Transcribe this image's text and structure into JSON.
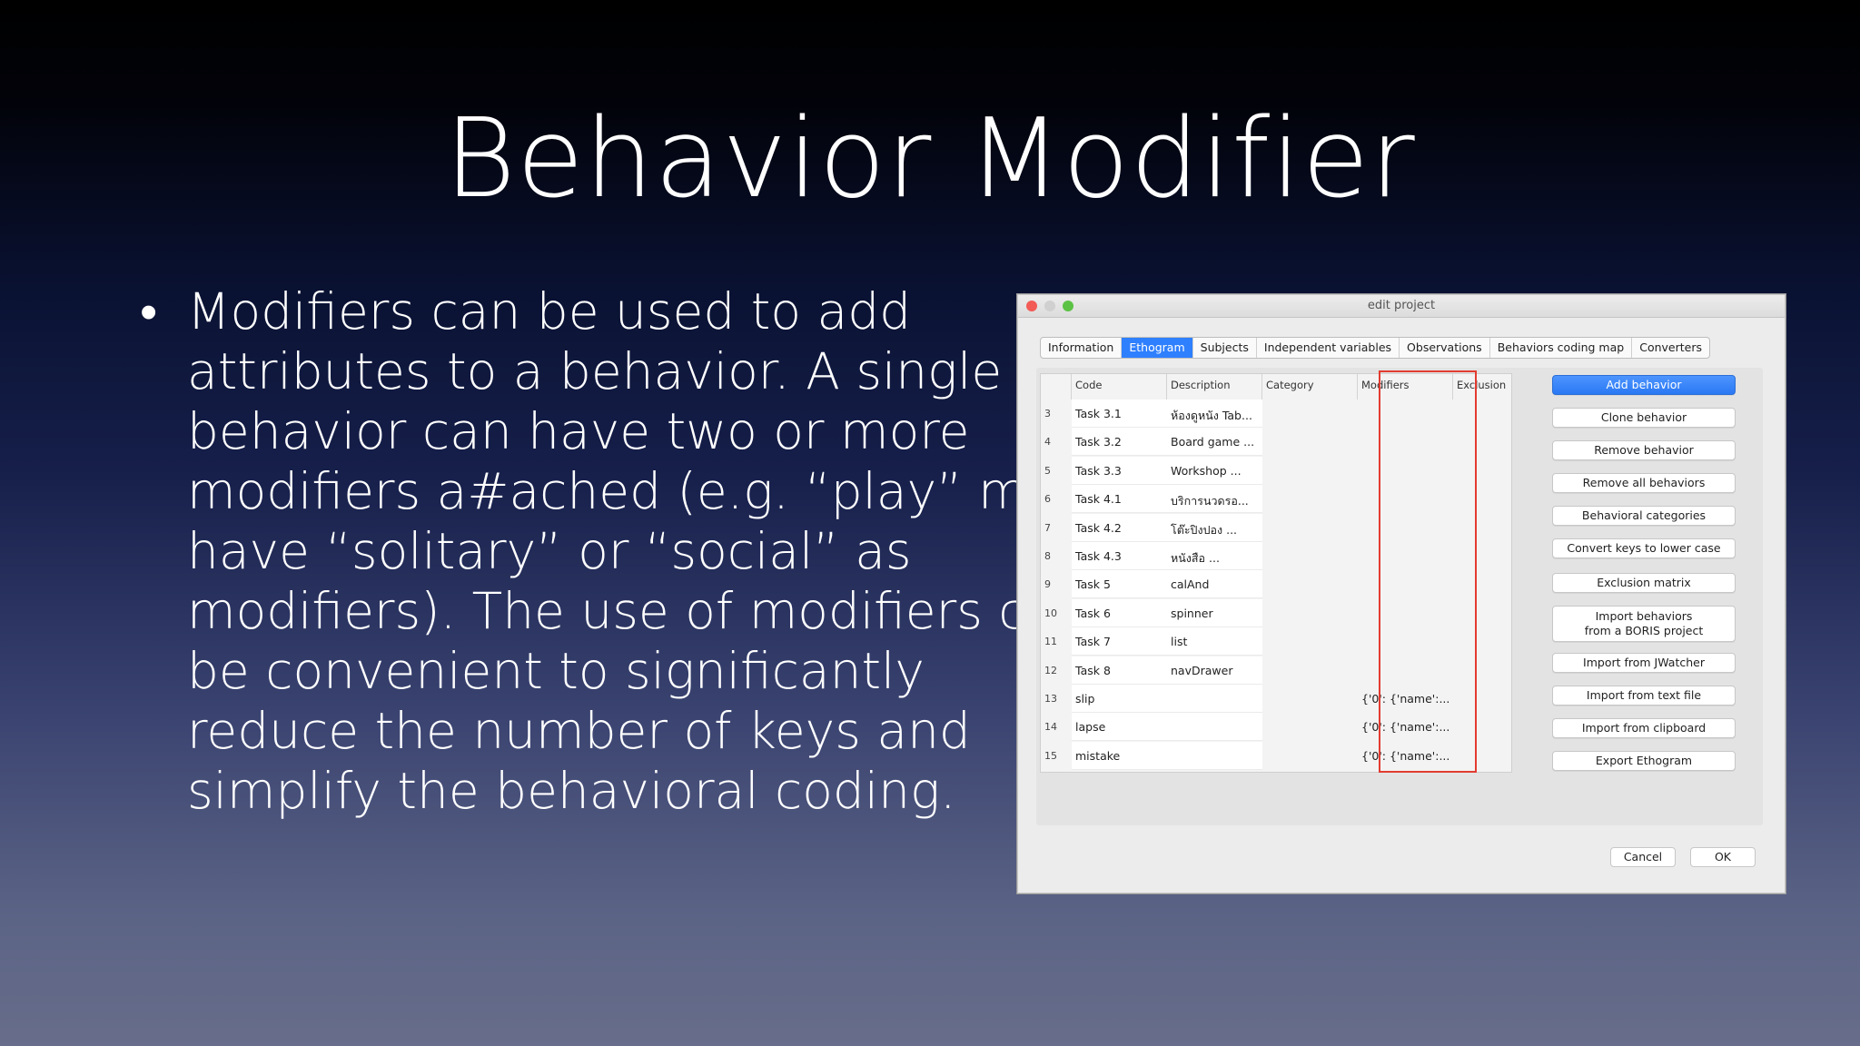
{
  "slide": {
    "title": "Behavior Modifier",
    "bullet": "Modifiers can be used to add\nattributes to a behavior. A single\nbehavior can have two or more\nmodifiers a#ached (e.g. “play” may\nhave “solitary” or “social” as\nmodifiers). The use of modifiers can\nbe convenient to significantly\nreduce the number of keys and\nsimplify the behavioral coding."
  },
  "window": {
    "title": "edit project",
    "tabs": [
      "Information",
      "Ethogram",
      "Subjects",
      "Independent variables",
      "Observations",
      "Behaviors coding map",
      "Converters"
    ],
    "active_tab": "Ethogram",
    "columns": {
      "code": "Code",
      "description": "Description",
      "category": "Category",
      "modifiers": "Modifiers",
      "exclusion": "Exclusion"
    },
    "rows": [
      {
        "idx": "3",
        "code": "Task 3.1",
        "desc": "ห้องดูหนัง Tab...",
        "mod": ""
      },
      {
        "idx": "4",
        "code": "Task 3.2",
        "desc": "Board game ...",
        "mod": ""
      },
      {
        "idx": "5",
        "code": "Task 3.3",
        "desc": "Workshop ...",
        "mod": ""
      },
      {
        "idx": "6",
        "code": "Task 4.1",
        "desc": "บริการนวดรอ...",
        "mod": ""
      },
      {
        "idx": "7",
        "code": "Task 4.2",
        "desc": "โต๊ะปิงปอง ...",
        "mod": ""
      },
      {
        "idx": "8",
        "code": "Task 4.3",
        "desc": "หนังสือ ...",
        "mod": ""
      },
      {
        "idx": "9",
        "code": "Task 5",
        "desc": "calAnd",
        "mod": ""
      },
      {
        "idx": "10",
        "code": "Task 6",
        "desc": "spinner",
        "mod": ""
      },
      {
        "idx": "11",
        "code": "Task 7",
        "desc": "list",
        "mod": ""
      },
      {
        "idx": "12",
        "code": "Task 8",
        "desc": "navDrawer",
        "mod": ""
      },
      {
        "idx": "13",
        "code": "slip",
        "desc": "",
        "mod": "{'0': {'name':..."
      },
      {
        "idx": "14",
        "code": "lapse",
        "desc": "",
        "mod": "{'0': {'name':..."
      },
      {
        "idx": "15",
        "code": "mistake",
        "desc": "",
        "mod": "{'0': {'name':..."
      }
    ],
    "buttons": {
      "add": "Add behavior",
      "clone": "Clone behavior",
      "remove": "Remove behavior",
      "remove_all": "Remove all behaviors",
      "categories": "Behavioral categories",
      "lower": "Convert keys to lower case",
      "exclusion": "Exclusion matrix",
      "import_boris": "Import behaviors\nfrom a BORIS project",
      "import_jwatcher": "Import from JWatcher",
      "import_text": "Import from text file",
      "import_clipboard": "Import from clipboard",
      "export": "Export Ethogram"
    },
    "cancel": "Cancel",
    "ok": "OK"
  }
}
